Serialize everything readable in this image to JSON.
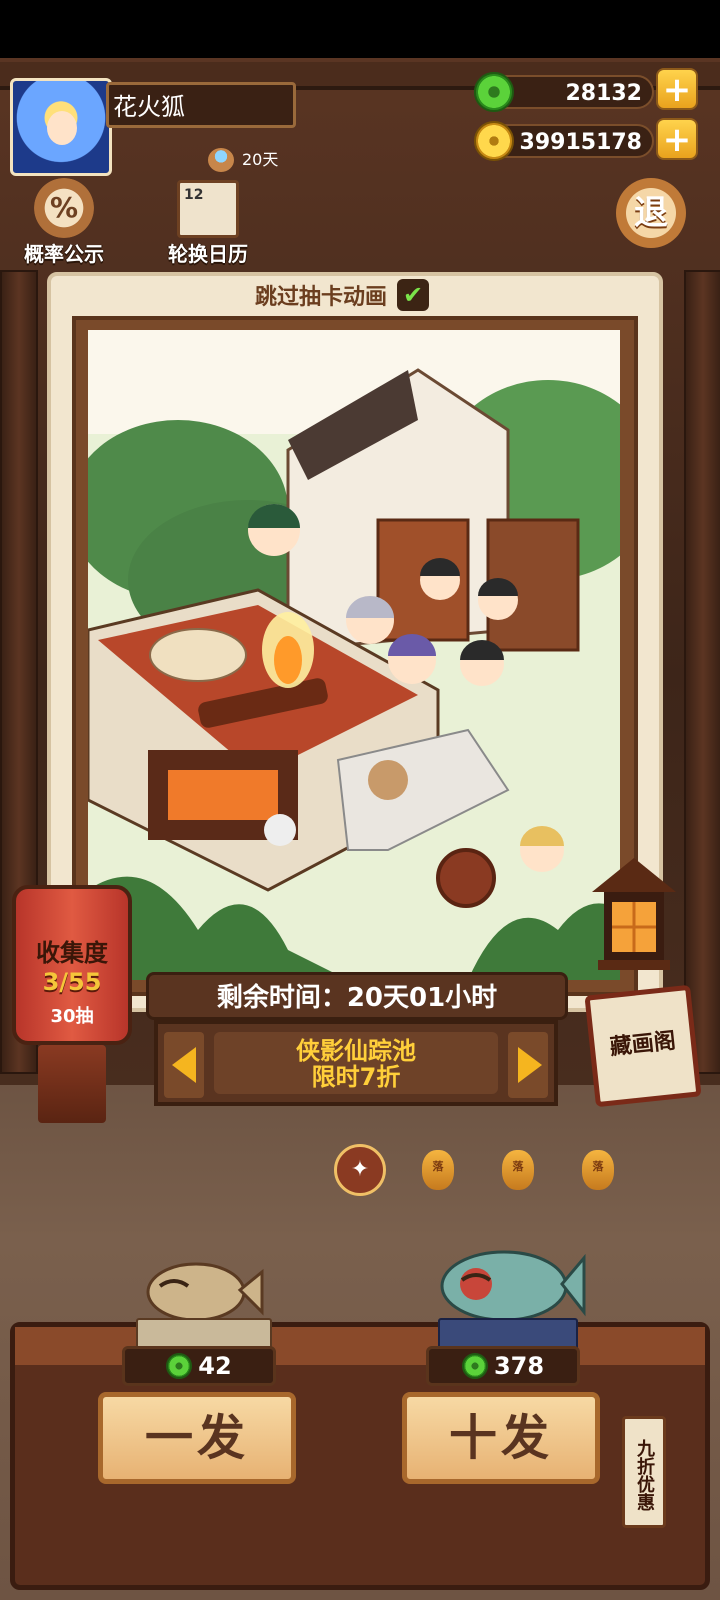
{
  "player": {
    "name": "花火狐",
    "days": "20天"
  },
  "currency": {
    "jade": "28132",
    "coins": "39915178"
  },
  "toolbar": {
    "probability_label": "概率公示",
    "probability_icon_text": "%",
    "calendar_label": "轮换日历",
    "calendar_icon_text": "12",
    "exit_label": "退"
  },
  "card": {
    "skip_animation_label": "跳过抽卡动画",
    "skip_checked": true
  },
  "collection": {
    "label": "收集度",
    "progress": "3/55",
    "pulls": "30抽"
  },
  "timer": {
    "text": "剩余时间：20天01小时"
  },
  "pool": {
    "name": "侠影仙踪池",
    "promo": "限时7折"
  },
  "gallery": {
    "label": "藏画阁"
  },
  "page_indicator": {
    "current": 0,
    "lamp_text": "落"
  },
  "draws": {
    "single": {
      "label": "一发",
      "cost": "42"
    },
    "ten": {
      "label": "十发",
      "cost": "378"
    },
    "discount_tag": "九折优惠"
  },
  "colors": {
    "accent_gold": "#ffcf3a",
    "jade_green": "#5bd23a",
    "wood": "#5a3420"
  }
}
